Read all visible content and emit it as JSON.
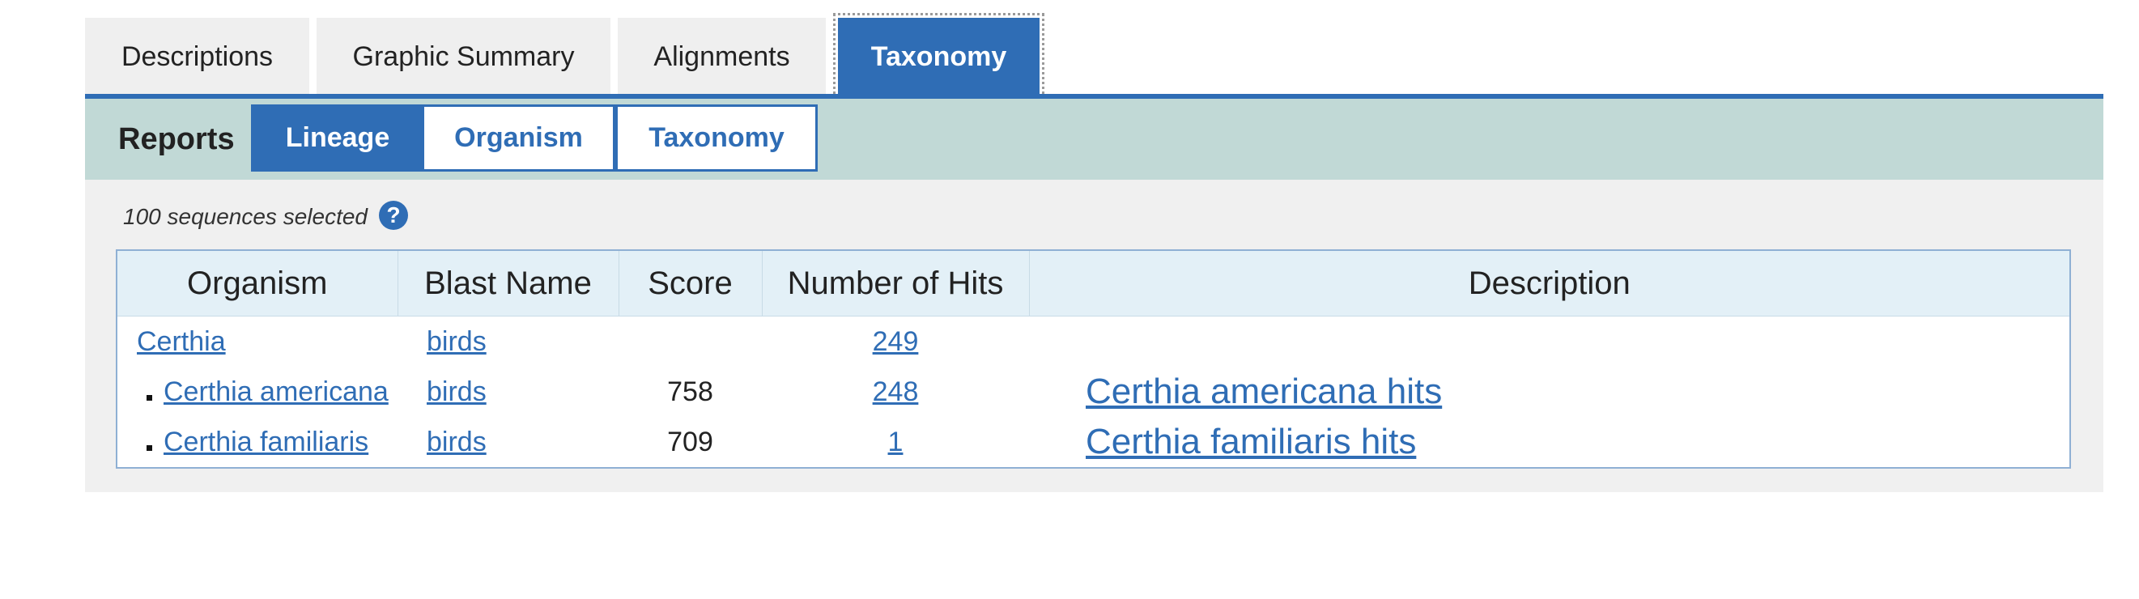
{
  "tabs": [
    {
      "label": "Descriptions"
    },
    {
      "label": "Graphic Summary"
    },
    {
      "label": "Alignments"
    },
    {
      "label": "Taxonomy",
      "active": true
    }
  ],
  "reports": {
    "label": "Reports",
    "buttons": [
      {
        "label": "Lineage",
        "active": true
      },
      {
        "label": "Organism"
      },
      {
        "label": "Taxonomy"
      }
    ]
  },
  "selection": {
    "text": "100 sequences selected",
    "help_icon": "question-circle-icon"
  },
  "table": {
    "headers": [
      "Organism",
      "Blast Name",
      "Score",
      "Number of Hits",
      "Description"
    ],
    "rows": [
      {
        "organism": "Certhia",
        "blast_name": "birds",
        "score": "",
        "hits": "249",
        "description": ""
      },
      {
        "organism": "Certhia americana",
        "blast_name": "birds",
        "score": "758",
        "hits": "248",
        "description": "Certhia americana hits"
      },
      {
        "organism": "Certhia familiaris",
        "blast_name": "birds",
        "score": "709",
        "hits": "1",
        "description": "Certhia familiaris hits"
      }
    ]
  },
  "colors": {
    "accent": "#2f6db5",
    "reports_bar": "#c1d9d6",
    "panel": "#f0f0f0",
    "header_bg": "#e3f0f7"
  }
}
